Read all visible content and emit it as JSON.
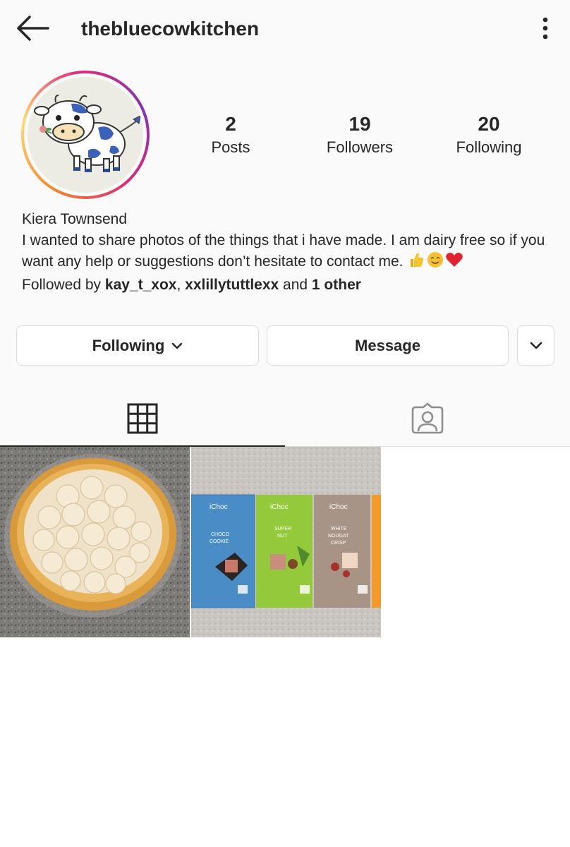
{
  "header": {
    "username": "thebluecowkitchen"
  },
  "stats": {
    "posts_count": "2",
    "posts_label": "Posts",
    "followers_count": "19",
    "followers_label": "Followers",
    "following_count": "20",
    "following_label": "Following"
  },
  "bio": {
    "name": "Kiera Townsend",
    "text": "I wanted to share photos of the things that i have made. I am dairy free so if you want any help or suggestions don’t hesitate to contact me.",
    "followed_by_prefix": "Followed by ",
    "followed_user_1": "kay_t_xox",
    "separator": ", ",
    "followed_user_2": "xxlillytuttlexx",
    "and_text": " and ",
    "others": "1 other"
  },
  "actions": {
    "following_label": "Following",
    "message_label": "Message"
  },
  "post2": {
    "bar1_brand": "iChoc",
    "bar1_flavor_1": "CHOCO",
    "bar1_flavor_2": "COOKIE",
    "bar2_brand": "iChoc",
    "bar2_flavor_1": "SUPER",
    "bar2_flavor_2": "NUT",
    "bar3_brand": "iChoc",
    "bar3_flavor_1": "WHITE",
    "bar3_flavor_2": "NOUGAT",
    "bar3_flavor_3": "CRISP"
  },
  "icons": {
    "back": "arrow-left-icon",
    "more": "more-vertical-icon",
    "chevron": "chevron-down-icon",
    "grid": "grid-icon",
    "tagged": "tagged-person-icon"
  },
  "colors": {
    "text": "#262626",
    "border": "#dbdbdb",
    "background": "#fafafa",
    "heart": "#e0242f",
    "emoji_yellow": "#f7c22f"
  }
}
